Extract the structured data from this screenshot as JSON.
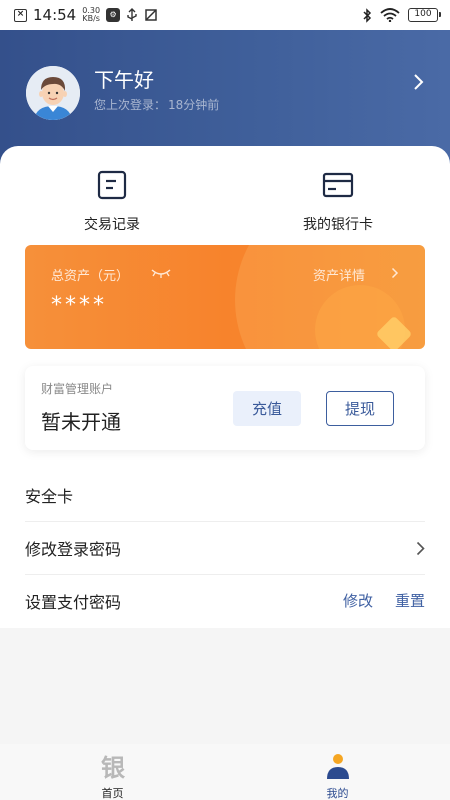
{
  "status_bar": {
    "time": "14:54",
    "net_speed_value": "0.30",
    "net_speed_unit": "KB/s",
    "battery": "100"
  },
  "header": {
    "greeting": "下午好",
    "last_login_label": "您上次登录：",
    "last_login_value": "18分钟前"
  },
  "quick_actions": [
    {
      "label": "交易记录",
      "icon": "transaction-record-icon"
    },
    {
      "label": "我的银行卡",
      "icon": "bank-card-icon"
    }
  ],
  "asset_card": {
    "title": "总资产（元）",
    "detail_link": "资产详情",
    "masked_value": "****",
    "colors": {
      "start": "#f6903a",
      "end": "#f59230"
    }
  },
  "wealth_account": {
    "label": "财富管理账户",
    "status": "暂未开通",
    "recharge_label": "充值",
    "withdraw_label": "提现"
  },
  "settings": {
    "security_card": "安全卡",
    "change_login_password": "修改登录密码",
    "set_pay_password": "设置支付密码",
    "modify_label": "修改",
    "reset_label": "重置"
  },
  "tabbar": {
    "tabs": [
      {
        "label": "首页",
        "icon": "home-yin-icon",
        "active": false
      },
      {
        "label": "我的",
        "icon": "user-profile-icon",
        "active": true
      }
    ],
    "active_color": "#2b4a8f",
    "accent_color": "#f5a623"
  }
}
